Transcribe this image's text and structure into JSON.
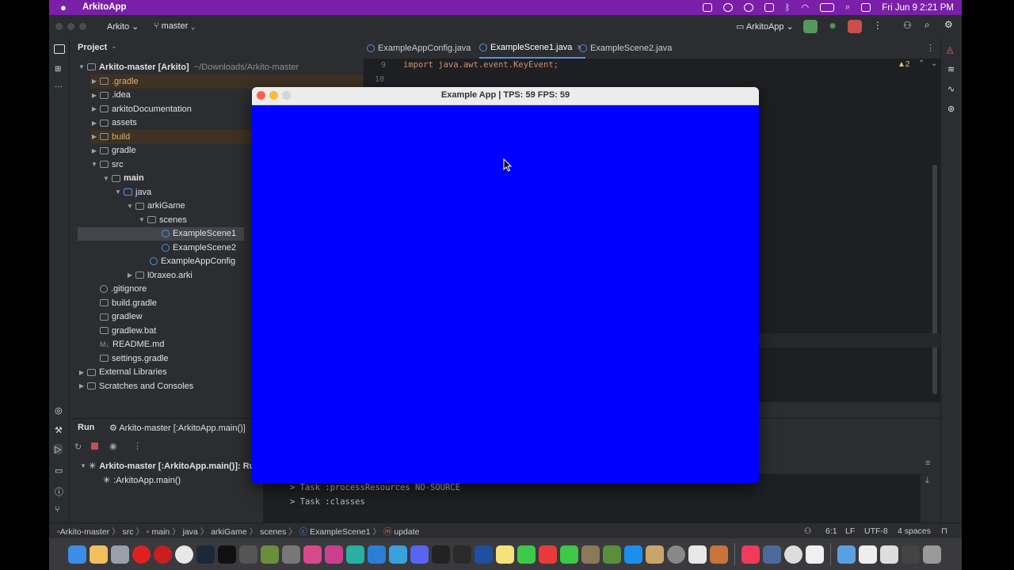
{
  "menubar": {
    "app_name": "ArkitoApp",
    "clock": "Fri Jun 9  2:21 PM"
  },
  "ide": {
    "project_name": "Arkito",
    "branch": "master",
    "run_config": "ArkitoApp",
    "panel_title": "Project",
    "tabs": [
      {
        "label": "ExampleAppConfig.java"
      },
      {
        "label": "ExampleScene1.java"
      },
      {
        "label": "ExampleScene2.java"
      }
    ],
    "editor": {
      "line9_no": "9",
      "line10_no": "10",
      "line9_code": "import java.awt.event.KeyEvent;",
      "warnings": "▲2"
    },
    "tree": [
      {
        "label": "Arkito-master [Arkito]",
        "suffix": "~/Downloads/Arkito-master"
      },
      {
        "label": ".gradle"
      },
      {
        "label": ".idea"
      },
      {
        "label": "arkitoDocumentation"
      },
      {
        "label": "assets"
      },
      {
        "label": "build"
      },
      {
        "label": "gradle"
      },
      {
        "label": "src"
      },
      {
        "label": "main"
      },
      {
        "label": "java"
      },
      {
        "label": "arkiGame"
      },
      {
        "label": "scenes"
      },
      {
        "label": "ExampleScene1"
      },
      {
        "label": "ExampleScene2"
      },
      {
        "label": "ExampleAppConfig"
      },
      {
        "label": "l0raxeo.arki"
      },
      {
        "label": ".gitignore"
      },
      {
        "label": "build.gradle"
      },
      {
        "label": "gradlew"
      },
      {
        "label": "gradlew.bat"
      },
      {
        "label": "README.md"
      },
      {
        "label": "settings.gradle"
      },
      {
        "label": "External Libraries"
      },
      {
        "label": "Scratches and Consoles"
      }
    ],
    "run": {
      "title": "Run",
      "config_tab": "Arkito-master [:ArkitoApp.main()]",
      "tree_root": "Arkito-master [:ArkitoApp.main()]: Ru",
      "tree_child": ":ArkitoApp.main()",
      "console": [
        "> Task :processResources NO-SOURCE",
        "> Task :classes"
      ]
    },
    "status": {
      "crumbs": [
        "Arkito-master",
        "src",
        "main",
        "java",
        "arkiGame",
        "scenes",
        "ExampleScene1",
        "update"
      ],
      "position": "6:1",
      "line_sep": "LF",
      "encoding": "UTF-8",
      "indent": "4 spaces"
    }
  },
  "app_window": {
    "title": "Example App | TPS: 59 FPS: 59",
    "canvas_color": "#0000ff"
  },
  "colors": {
    "menubar": "#7a1fa8",
    "ide_bg": "#2b2d30",
    "editor_bg": "#1e1f22",
    "accent_blue": "#5a8ee6"
  }
}
